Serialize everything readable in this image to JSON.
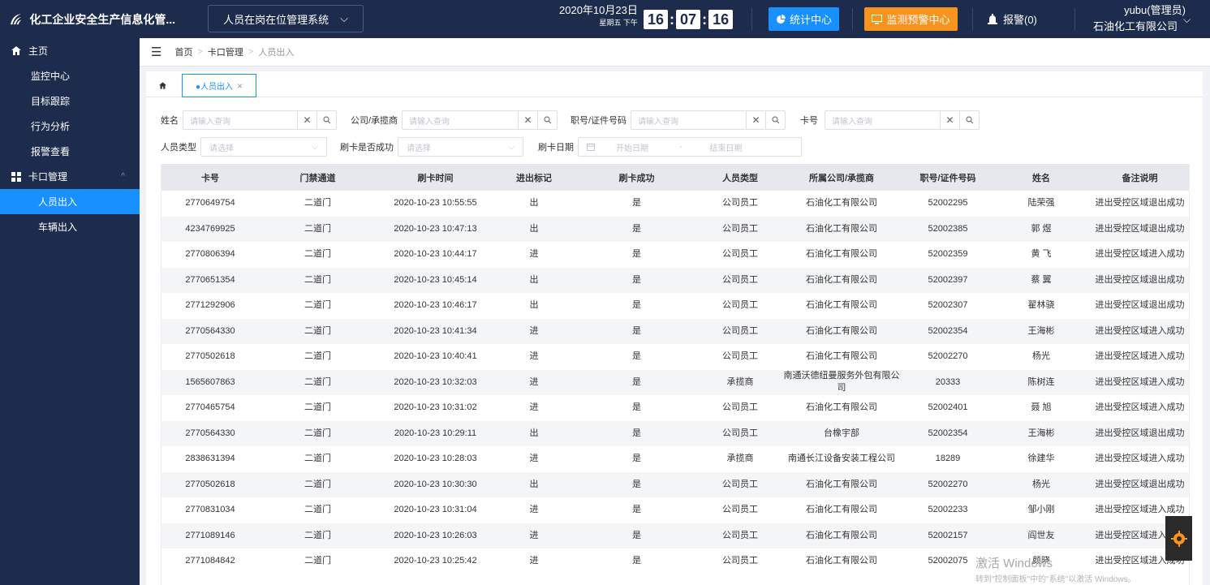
{
  "header": {
    "app_title": "化工企业安全生产信息化管...",
    "system_select": "人员在岗在位管理系统",
    "date": "2020年10月23日",
    "weekday": "星期五 下午",
    "clock": {
      "h": "16",
      "m": "07",
      "s": "16"
    },
    "stat_button": "统计中心",
    "monitor_button": "监测预警中心",
    "alarm": "报警(0)",
    "user_name": "yubu(管理员)",
    "user_company": "石油化工有限公司"
  },
  "sidebar": {
    "home": "主页",
    "items": [
      "监控中心",
      "目标跟踪",
      "行为分析",
      "报警查看"
    ],
    "group": "卡口管理",
    "sub_items": [
      "人员出入",
      "车辆出入"
    ]
  },
  "breadcrumb": [
    "首页",
    "卡口管理",
    "人员出入"
  ],
  "tab": {
    "active_label": "●人员出入"
  },
  "filters": {
    "name_label": "姓名",
    "name_placeholder": "请输入查询",
    "company_label": "公司/承揽商",
    "company_placeholder": "请输入查询",
    "idno_label": "职号/证件号码",
    "idno_placeholder": "请输入查询",
    "card_label": "卡号",
    "card_placeholder": "请输入查询",
    "ptype_label": "人员类型",
    "ptype_placeholder": "请选择",
    "success_label": "刷卡是否成功",
    "success_placeholder": "请选择",
    "date_label": "刷卡日期",
    "date_start": "开始日期",
    "date_sep": "-",
    "date_end": "结束日期"
  },
  "table": {
    "columns": [
      "卡号",
      "门禁通道",
      "刷卡时间",
      "进出标记",
      "刷卡成功",
      "人员类型",
      "所属公司/承揽商",
      "职号/证件号码",
      "姓名",
      "备注说明"
    ],
    "rows": [
      [
        "2770649754",
        "二道门",
        "2020-10-23 10:55:55",
        "出",
        "是",
        "公司员工",
        "石油化工有限公司",
        "52002295",
        "陆荣强",
        "进出受控区域退出成功"
      ],
      [
        "4234769925",
        "二道门",
        "2020-10-23 10:47:13",
        "出",
        "是",
        "公司员工",
        "石油化工有限公司",
        "52002385",
        "郭 煜",
        "进出受控区域退出成功"
      ],
      [
        "2770806394",
        "二道门",
        "2020-10-23 10:44:17",
        "进",
        "是",
        "公司员工",
        "石油化工有限公司",
        "52002359",
        "黄 飞",
        "进出受控区域进入成功"
      ],
      [
        "2770651354",
        "二道门",
        "2020-10-23 10:45:14",
        "出",
        "是",
        "公司员工",
        "石油化工有限公司",
        "52002397",
        "蔡 翼",
        "进出受控区域退出成功"
      ],
      [
        "2771292906",
        "二道门",
        "2020-10-23 10:46:17",
        "出",
        "是",
        "公司员工",
        "石油化工有限公司",
        "52002307",
        "翟林骁",
        "进出受控区域退出成功"
      ],
      [
        "2770564330",
        "二道门",
        "2020-10-23 10:41:34",
        "进",
        "是",
        "公司员工",
        "石油化工有限公司",
        "52002354",
        "王海彬",
        "进出受控区域进入成功"
      ],
      [
        "2770502618",
        "二道门",
        "2020-10-23 10:40:41",
        "进",
        "是",
        "公司员工",
        "石油化工有限公司",
        "52002270",
        "杨光",
        "进出受控区域进入成功"
      ],
      [
        "1565607863",
        "二道门",
        "2020-10-23 10:32:03",
        "进",
        "是",
        "承揽商",
        "南通沃德纽曼服务外包有限公司",
        "20333",
        "陈树连",
        "进出受控区域进入成功"
      ],
      [
        "2770465754",
        "二道门",
        "2020-10-23 10:31:02",
        "进",
        "是",
        "公司员工",
        "石油化工有限公司",
        "52002401",
        "聂 旭",
        "进出受控区域进入成功"
      ],
      [
        "2770564330",
        "二道门",
        "2020-10-23 10:29:11",
        "出",
        "是",
        "公司员工",
        "台橡宇部",
        "52002354",
        "王海彬",
        "进出受控区域退出成功"
      ],
      [
        "2838631394",
        "二道门",
        "2020-10-23 10:28:03",
        "进",
        "是",
        "承揽商",
        "南通长江设备安装工程公司",
        "18289",
        "徐建华",
        "进出受控区域进入成功"
      ],
      [
        "2770502618",
        "二道门",
        "2020-10-23 10:30:30",
        "出",
        "是",
        "公司员工",
        "石油化工有限公司",
        "52002270",
        "杨光",
        "进出受控区域退出成功"
      ],
      [
        "2770831034",
        "二道门",
        "2020-10-23 10:31:04",
        "进",
        "是",
        "公司员工",
        "石油化工有限公司",
        "52002233",
        "邹小刚",
        "进出受控区域进入成功"
      ],
      [
        "2771089146",
        "二道门",
        "2020-10-23 10:26:03",
        "进",
        "是",
        "公司员工",
        "石油化工有限公司",
        "52002157",
        "阎世友",
        "进出受控区域进入成功"
      ],
      [
        "2771084842",
        "二道门",
        "2020-10-23 10:25:42",
        "进",
        "是",
        "公司员工",
        "石油化工有限公司",
        "52002075",
        "颜晓",
        "进出受控区域进入成功"
      ]
    ]
  },
  "watermark": {
    "line1": "激活 Windows",
    "line2": "转到\"控制面板\"中的\"系统\"以激活 Windows。"
  }
}
